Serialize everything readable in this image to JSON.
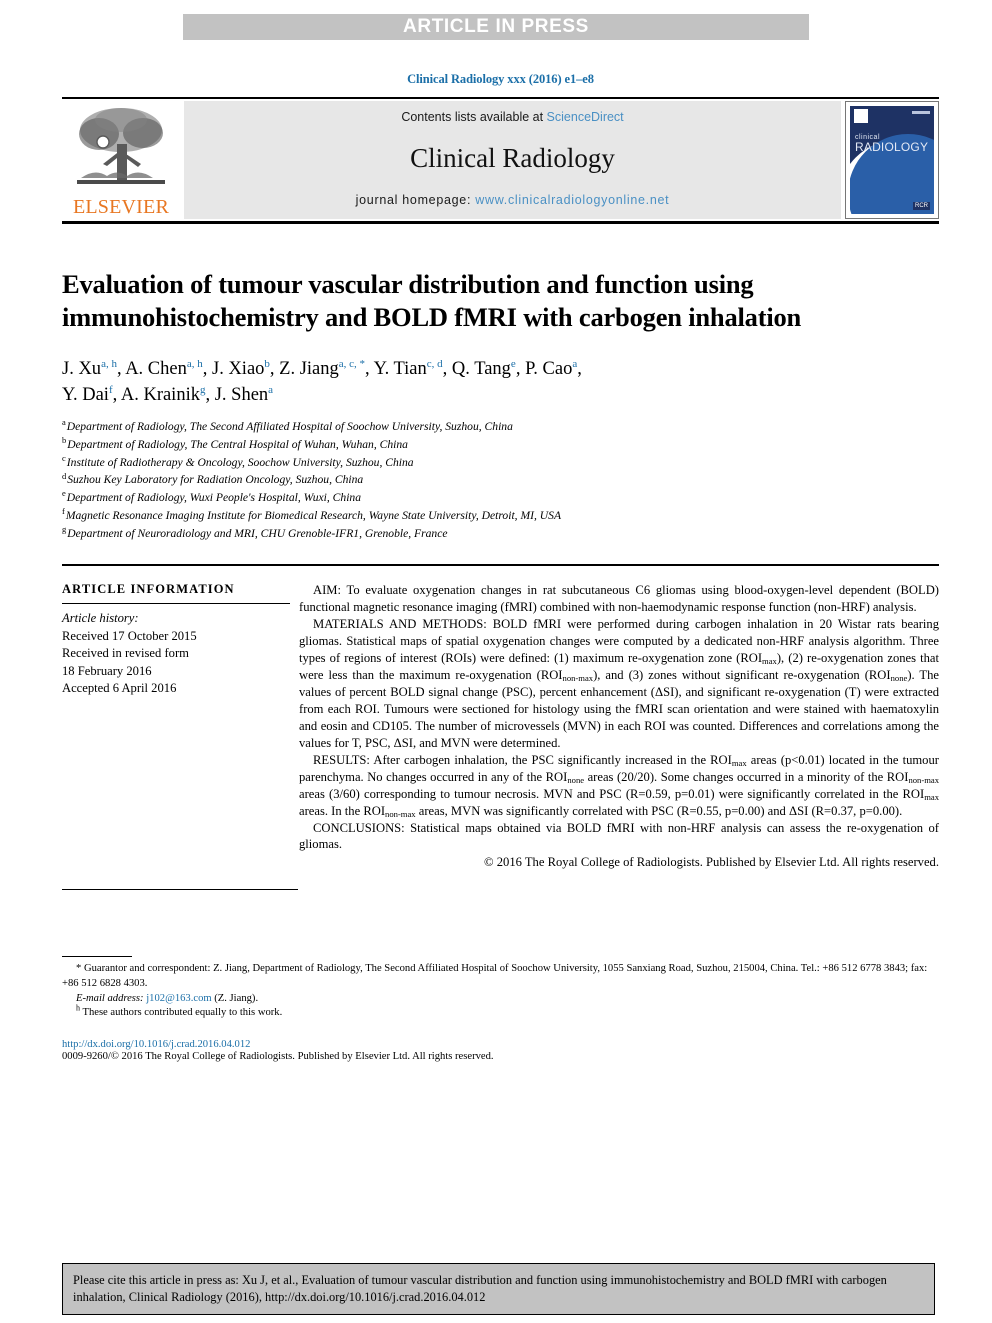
{
  "banner": {
    "label": "ARTICLE IN PRESS"
  },
  "running_head": "Clinical Radiology xxx (2016) e1–e8",
  "masthead": {
    "publisher_word": "ELSEVIER",
    "contents_prefix": "Contents lists available at ",
    "contents_link": "ScienceDirect",
    "journal_name": "Clinical Radiology",
    "homepage_prefix": "journal homepage: ",
    "homepage_url": "www.clinicalradiologyonline.net",
    "cover": {
      "line1": "clinical",
      "line2": "RADIOLOGY",
      "badge": "RCR"
    }
  },
  "article": {
    "title": "Evaluation of tumour vascular distribution and function using immunohistochemistry and BOLD fMRI with carbogen inhalation",
    "authors_line1": "J. Xu",
    "authors": [
      {
        "name": "J. Xu",
        "sup": "a, h"
      },
      {
        "name": "A. Chen",
        "sup": "a, h"
      },
      {
        "name": "J. Xiao",
        "sup": "b"
      },
      {
        "name": "Z. Jiang",
        "sup": "a, c, *"
      },
      {
        "name": "Y. Tian",
        "sup": "c, d"
      },
      {
        "name": "Q. Tang",
        "sup": "e"
      },
      {
        "name": "P. Cao",
        "sup": "a"
      },
      {
        "name": "Y. Dai",
        "sup": "f"
      },
      {
        "name": "A. Krainik",
        "sup": "g"
      },
      {
        "name": "J. Shen",
        "sup": "a"
      }
    ],
    "affiliations": [
      {
        "mark": "a",
        "text": "Department of Radiology, The Second Affiliated Hospital of Soochow University, Suzhou, China"
      },
      {
        "mark": "b",
        "text": "Department of Radiology, The Central Hospital of Wuhan, Wuhan, China"
      },
      {
        "mark": "c",
        "text": "Institute of Radiotherapy & Oncology, Soochow University, Suzhou, China"
      },
      {
        "mark": "d",
        "text": "Suzhou Key Laboratory for Radiation Oncology, Suzhou, China"
      },
      {
        "mark": "e",
        "text": "Department of Radiology, Wuxi People's Hospital, Wuxi, China"
      },
      {
        "mark": "f",
        "text": "Magnetic Resonance Imaging Institute for Biomedical Research, Wayne State University, Detroit, MI, USA"
      },
      {
        "mark": "g",
        "text": "Department of Neuroradiology and MRI, CHU Grenoble-IFR1, Grenoble, France"
      }
    ]
  },
  "article_info": {
    "heading": "ARTICLE INFORMATION",
    "history_label": "Article history:",
    "received": "Received 17 October 2015",
    "revised_label": "Received in revised form",
    "revised_date": "18 February 2016",
    "accepted": "Accepted 6 April 2016"
  },
  "abstract": {
    "aim_label": "AIM:",
    "aim_text": " To evaluate oxygenation changes in rat subcutaneous C6 gliomas using blood-oxygen-level dependent (BOLD) functional magnetic resonance imaging (fMRI) combined with non-haemodynamic response function (non-HRF) analysis.",
    "methods_label": "MATERIALS AND METHODS:",
    "methods_p1": " BOLD fMRI were performed during carbogen inhalation in 20 Wistar rats bearing gliomas. Statistical maps of spatial oxygenation changes were computed by a dedicated non-HRF analysis algorithm. Three types of regions of interest (ROIs) were defined: (1) maximum re-oxygenation zone (ROI",
    "methods_sub1": "max",
    "methods_p2": "), (2) re-oxygenation zones that were less than the maximum re-oxygenation (ROI",
    "methods_sub2": "non-max",
    "methods_p3": "), and (3) zones without significant re-oxygenation (ROI",
    "methods_sub3": "none",
    "methods_p4": "). The values of percent BOLD signal change (PSC), percent enhancement (ΔSI), and significant re-oxygenation (T) were extracted from each ROI. Tumours were sectioned for histology using the fMRI scan orientation and were stained with haematoxylin and eosin and CD105. The number of microvessels (MVN) in each ROI was counted. Differences and correlations among the values for T, PSC, ΔSI, and MVN were determined.",
    "results_label": "RESULTS:",
    "results_p1": " After carbogen inhalation, the PSC significantly increased in the ROI",
    "results_sub1": "max",
    "results_p2": " areas (p<0.01) located in the tumour parenchyma. No changes occurred in any of the ROI",
    "results_sub2": "none",
    "results_p3": " areas (20/20). Some changes occurred in a minority of the ROI",
    "results_sub3": "non-max",
    "results_p4": " areas (3/60) corresponding to tumour necrosis. MVN and PSC (R=0.59, p=0.01) were significantly correlated in the ROI",
    "results_sub4": "max",
    "results_p5": " areas. In the ROI",
    "results_sub5": "non-max",
    "results_p6": " areas, MVN was significantly correlated with PSC (R=0.55, p=0.00) and ΔSI (R=0.37, p=0.00).",
    "conclusions_label": "CONCLUSIONS:",
    "conclusions_text": " Statistical maps obtained via BOLD fMRI with non-HRF analysis can assess the re-oxygenation of gliomas.",
    "copyright": "© 2016 The Royal College of Radiologists. Published by Elsevier Ltd. All rights reserved."
  },
  "footnotes": {
    "corresponding": "* Guarantor and correspondent: Z. Jiang, Department of Radiology, The Second Affiliated Hospital of Soochow University, 1055 Sanxiang Road, Suzhou, 215004, China. Tel.: +86 512 6778 3843; fax: +86 512 6828 4303.",
    "email_label": "E-mail address:",
    "email": "j102@163.com",
    "email_suffix": "(Z. Jiang).",
    "equal_mark": "h",
    "equal_contrib": "These authors contributed equally to this work."
  },
  "doi": "http://dx.doi.org/10.1016/j.crad.2016.04.012",
  "issn_line": "0009-9260/© 2016 The Royal College of Radiologists. Published by Elsevier Ltd. All rights reserved.",
  "citation_box": "Please cite this article in press as: Xu J, et al., Evaluation of tumour vascular distribution and function using immunohistochemistry and BOLD fMRI with carbogen inhalation, Clinical Radiology (2016), http://dx.doi.org/10.1016/j.crad.2016.04.012",
  "colors": {
    "link_blue": "#1b6fa8",
    "sciencedirect_blue": "#4a90c4",
    "elsevier_orange": "#e87722",
    "banner_grey": "#c2c2c2",
    "masthead_grey": "#e7e7e7",
    "cover_navy": "#1e3264"
  }
}
